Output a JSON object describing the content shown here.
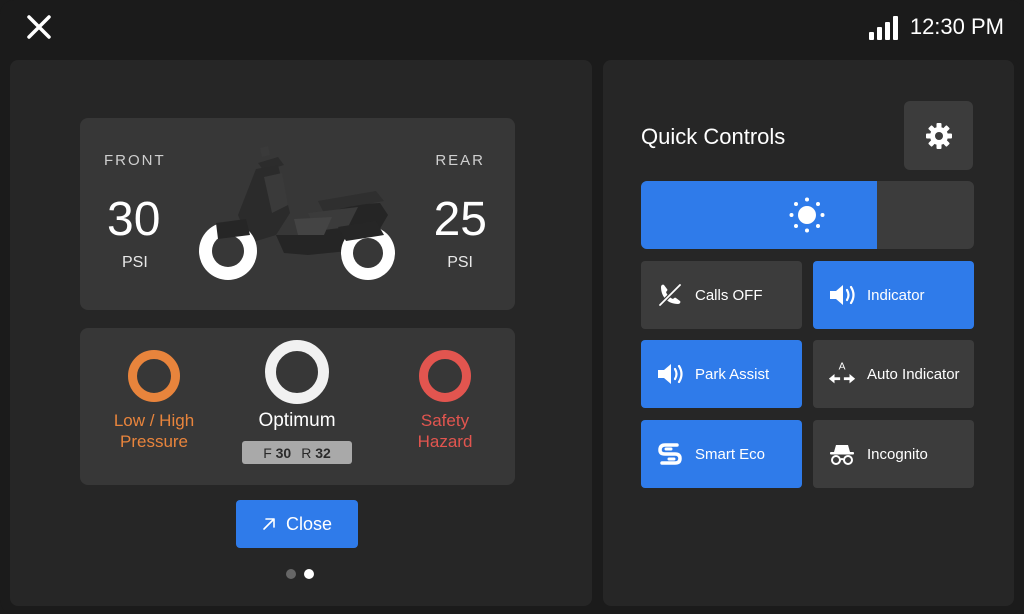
{
  "status_bar": {
    "time": "12:30 PM"
  },
  "tyre": {
    "front_label": "FRONT",
    "rear_label": "REAR",
    "front_value": "30",
    "rear_value": "25",
    "unit": "PSI"
  },
  "tyre_status": {
    "low_high_label": "Low / High\nPressure",
    "optimum_label": "Optimum",
    "hazard_label": "Safety\nHazard",
    "chip": {
      "front_prefix": "F",
      "front_value": "30",
      "rear_prefix": "R",
      "rear_value": "32"
    }
  },
  "close_button": {
    "label": "Close"
  },
  "pager": {
    "count": 2,
    "active_index": 1
  },
  "quick_controls": {
    "title": "Quick Controls",
    "brightness_level": 0.71,
    "tiles": [
      {
        "label": "Calls OFF",
        "icon": "phone-off-icon",
        "on": false
      },
      {
        "label": "Indicator",
        "icon": "speaker-icon",
        "on": true
      },
      {
        "label": "Park Assist",
        "icon": "speaker-icon",
        "on": true
      },
      {
        "label": "Auto Indicator",
        "icon": "auto-arrows-icon",
        "on": false
      },
      {
        "label": "Smart Eco",
        "icon": "smart-eco-icon",
        "on": true
      },
      {
        "label": "Incognito",
        "icon": "incognito-icon",
        "on": false
      }
    ]
  },
  "colors": {
    "accent": "#2f7bea",
    "low_high": "#e8843c",
    "optimum": "#f1f1f1",
    "hazard": "#e2554f",
    "panel": "#262626",
    "card": "#373737"
  }
}
